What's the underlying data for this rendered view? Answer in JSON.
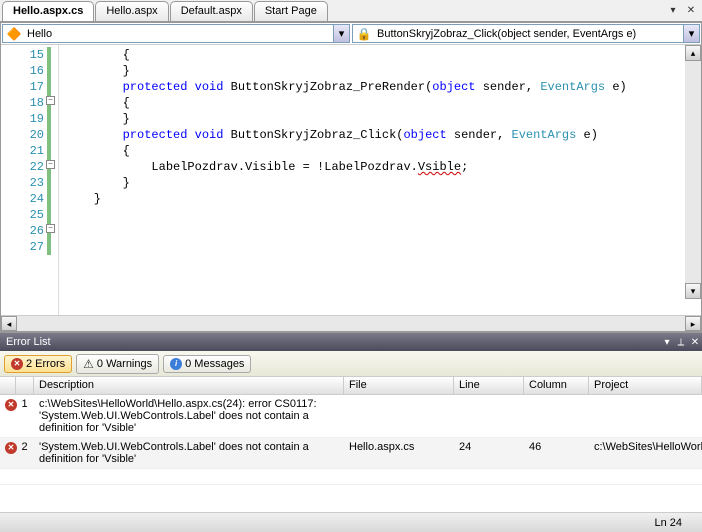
{
  "tabs": [
    "Hello.aspx.cs",
    "Hello.aspx",
    "Default.aspx",
    "Start Page"
  ],
  "activeTab": 0,
  "nav": {
    "classIcon": "🔶",
    "className": "Hello",
    "methodIcon": "🔒",
    "methodName": "ButtonSkryjZobraz_Click(object sender, EventArgs e)"
  },
  "code": {
    "startLine": 15,
    "lines": [
      {
        "n": 15,
        "t": "        {"
      },
      {
        "n": 16,
        "t": ""
      },
      {
        "n": 17,
        "t": "        }"
      },
      {
        "n": 18,
        "ol": true
      },
      {
        "n": 19,
        "t": "        {"
      },
      {
        "n": 20,
        "t": ""
      },
      {
        "n": 21,
        "t": "        }"
      },
      {
        "n": 22,
        "ol": true
      },
      {
        "n": 23,
        "t": "        {"
      },
      {
        "n": 24
      },
      {
        "n": 25,
        "t": "        }"
      },
      {
        "n": 26,
        "ol": true,
        "t": "    }"
      },
      {
        "n": 27,
        "t": ""
      }
    ],
    "line18": {
      "pre": "        ",
      "kw1": "protected",
      "s1": " ",
      "kw2": "void",
      "s2": " ButtonSkryjZobraz_PreRender(",
      "kw3": "object",
      "s3": " sender, ",
      "tp": "EventArgs",
      "s4": " e)"
    },
    "line22": {
      "pre": "        ",
      "kw1": "protected",
      "s1": " ",
      "kw2": "void",
      "s2": " ButtonSkryjZobraz_Click(",
      "kw3": "object",
      "s3": " sender, ",
      "tp": "EventArgs",
      "s4": " e)"
    },
    "line24": {
      "pre": "            LabelPozdrav.Visible = !LabelPozdrav.",
      "err": "Vsible",
      "post": ";"
    }
  },
  "errorList": {
    "title": "Error List",
    "filters": {
      "errors": "2 Errors",
      "warnings": "0 Warnings",
      "messages": "0 Messages"
    },
    "columns": {
      "desc": "Description",
      "file": "File",
      "line": "Line",
      "col": "Column",
      "proj": "Project"
    },
    "rows": [
      {
        "num": "1",
        "desc": "c:\\WebSites\\HelloWorld\\Hello.aspx.cs(24): error CS0117: 'System.Web.UI.WebControls.Label' does not contain a definition for 'Vsible'",
        "file": "",
        "line": "",
        "col": "",
        "proj": ""
      },
      {
        "num": "2",
        "desc": "'System.Web.UI.WebControls.Label' does not contain a definition for 'Vsible'",
        "file": "Hello.aspx.cs",
        "line": "24",
        "col": "46",
        "proj": "c:\\WebSites\\HelloWorld\\"
      }
    ]
  },
  "status": {
    "line": "Ln 24"
  }
}
